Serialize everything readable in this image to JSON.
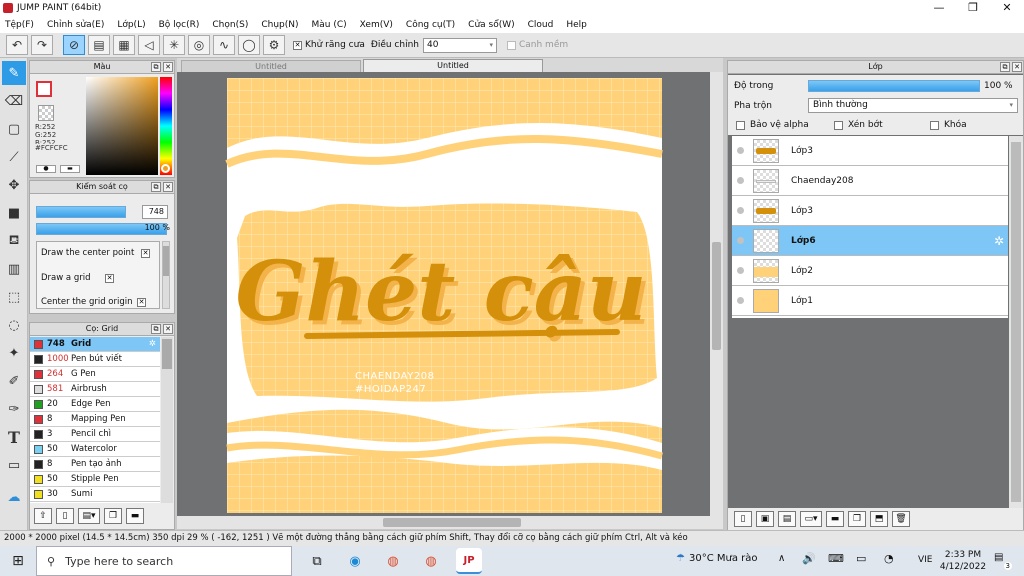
{
  "window": {
    "title": "JUMP PAINT (64bit)",
    "minimize": "—",
    "maximize": "❐",
    "close": "✕"
  },
  "menu": [
    "Tệp(F)",
    "Chỉnh sửa(E)",
    "Lớp(L)",
    "Bộ lọc(R)",
    "Chọn(S)",
    "Chụp(N)",
    "Màu (C)",
    "Xem(V)",
    "Công cụ(T)",
    "Cửa sổ(W)",
    "Cloud",
    "Help"
  ],
  "toolbar": {
    "antialias_label": "Khử răng cưa",
    "adjust_label": "Điều chỉnh",
    "adjust_value": "40",
    "snap_label": "Canh mềm"
  },
  "color_panel": {
    "title": "Màu",
    "r": "R:252",
    "g": "G:252",
    "b": "B:252",
    "hex": "#FCFCFC",
    "current": "#fcfcfc"
  },
  "brush_control": {
    "title": "Kiểm soát cọ",
    "size": "748",
    "opacity": "100 %",
    "size_fill": 0.9,
    "opacity_fill": 0.9,
    "options": [
      "Draw the center point",
      "Draw a grid",
      "Center the grid origin"
    ]
  },
  "brush_list": {
    "title": "Cọ: Grid",
    "items": [
      {
        "size": "748",
        "name": "Grid",
        "color": "#e0303a",
        "selected": true
      },
      {
        "size": "1000",
        "name": "Pen bút viết",
        "color": "#222222"
      },
      {
        "size": "264",
        "name": "G Pen",
        "color": "#e0303a"
      },
      {
        "size": "581",
        "name": "Airbrush",
        "color": "#dddddd"
      },
      {
        "size": "20",
        "name": "Edge Pen",
        "color": "#20a020"
      },
      {
        "size": "8",
        "name": "Mapping Pen",
        "color": "#e0303a"
      },
      {
        "size": "3",
        "name": "Pencil chì",
        "color": "#222222"
      },
      {
        "size": "50",
        "name": "Watercolor",
        "color": "#7ad0f0"
      },
      {
        "size": "8",
        "name": "Pen tạo ảnh",
        "color": "#222222"
      },
      {
        "size": "50",
        "name": "Stipple Pen",
        "color": "#f0e020"
      },
      {
        "size": "30",
        "name": "Sumi",
        "color": "#f0e020"
      }
    ]
  },
  "tabs": [
    "Untitled",
    "Untitled"
  ],
  "artwork": {
    "title_text": "Ghét cậu",
    "credit1": "CHAENDAY208",
    "credit2": "#HOIDAP247"
  },
  "layer_panel": {
    "title": "Lớp",
    "opacity_label": "Độ trong",
    "opacity_value": "100 %",
    "blend_label": "Pha trộn",
    "blend_value": "Bình thường",
    "protect_alpha": "Bảo vệ alpha",
    "clip": "Xén bớt",
    "lock": "Khóa",
    "layers": [
      {
        "name": "Lớp3",
        "thumb": "text"
      },
      {
        "name": "Chaenday208",
        "thumb": "line"
      },
      {
        "name": "Lớp3",
        "thumb": "text"
      },
      {
        "name": "Lớp6",
        "thumb": "empty",
        "selected": true
      },
      {
        "name": "Lớp2",
        "thumb": "band"
      },
      {
        "name": "Lớp1",
        "thumb": "full"
      }
    ]
  },
  "status": "2000 * 2000 pixel  (14.5 * 14.5cm)  350 dpi  29 %  ( -162, 1251 )  Vẽ một đường thẳng bằng cách giữ phím Shift, Thay đổi cỡ cọ bằng cách giữ phím Ctrl, Alt và kéo",
  "taskbar": {
    "search_placeholder": "Type here to search",
    "weather": "30°C  Mưa rào",
    "lang": "VIE",
    "time": "2:33 PM",
    "date": "4/12/2022",
    "notif": "3"
  }
}
